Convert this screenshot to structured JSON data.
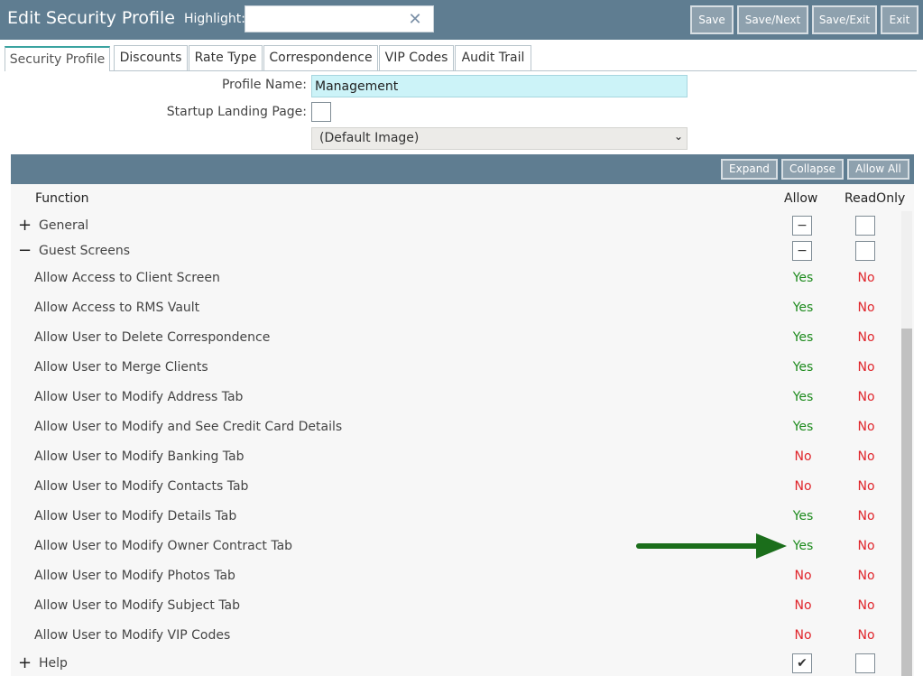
{
  "header": {
    "title": "Edit Security Profile",
    "highlight_label": "Highlight:",
    "highlight_value": "",
    "buttons": {
      "save": "Save",
      "save_next": "Save/Next",
      "save_exit": "Save/Exit",
      "exit": "Exit"
    }
  },
  "tabs": [
    "Security Profile",
    "Discounts",
    "Rate Type",
    "Correspondence",
    "VIP Codes",
    "Audit Trail"
  ],
  "form": {
    "profile_name_label": "Profile Name:",
    "profile_name_value": "Management",
    "landing_label": "Startup Landing Page:",
    "image_select_value": "(Default Image)"
  },
  "panel": {
    "expand": "Expand",
    "collapse": "Collapse",
    "allow_all": "Allow All"
  },
  "grid": {
    "col_function": "Function",
    "col_allow": "Allow",
    "col_readonly": "ReadOnly",
    "groups": {
      "general": {
        "toggle": "+",
        "label": "General"
      },
      "guest": {
        "toggle": "−",
        "label": "Guest Screens"
      },
      "help": {
        "toggle": "+",
        "label": "Help"
      }
    },
    "rows": [
      {
        "label": "Allow Access to Client Screen",
        "allow": "Yes",
        "readonly": "No"
      },
      {
        "label": "Allow Access to RMS Vault",
        "allow": "Yes",
        "readonly": "No"
      },
      {
        "label": "Allow User to Delete Correspondence",
        "allow": "Yes",
        "readonly": "No"
      },
      {
        "label": "Allow User to Merge Clients",
        "allow": "Yes",
        "readonly": "No"
      },
      {
        "label": "Allow User to Modify Address Tab",
        "allow": "Yes",
        "readonly": "No"
      },
      {
        "label": "Allow User to Modify and See Credit Card Details",
        "allow": "Yes",
        "readonly": "No"
      },
      {
        "label": "Allow User to Modify Banking Tab",
        "allow": "No",
        "readonly": "No"
      },
      {
        "label": "Allow User to Modify Contacts Tab",
        "allow": "No",
        "readonly": "No"
      },
      {
        "label": "Allow User to Modify Details Tab",
        "allow": "Yes",
        "readonly": "No"
      },
      {
        "label": "Allow User to Modify Owner Contract Tab",
        "allow": "Yes",
        "readonly": "No"
      },
      {
        "label": "Allow User to Modify Photos Tab",
        "allow": "No",
        "readonly": "No"
      },
      {
        "label": "Allow User to Modify Subject Tab",
        "allow": "No",
        "readonly": "No"
      },
      {
        "label": "Allow User to Modify VIP Codes",
        "allow": "No",
        "readonly": "No"
      }
    ]
  },
  "colors": {
    "header_bg": "#5f7d91",
    "yes": "#1d8a1d",
    "no": "#e0252b",
    "arrow": "#1b6e1b",
    "tab_accent": "#3aa3a0"
  }
}
